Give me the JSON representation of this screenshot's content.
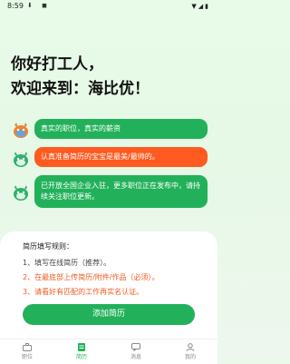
{
  "status": {
    "time": "8:59"
  },
  "headline": {
    "line1": "你好打工人，",
    "line2": "欢迎来到：海比优！"
  },
  "messages": [
    {
      "text": "真实的职位，真实的薪资"
    },
    {
      "text": "认真准备简历的宝宝是最美/最帅的。"
    },
    {
      "text": "已开放全国企业入驻，更多职位正在发布中，请持续关注职位更新。"
    }
  ],
  "card": {
    "title": "简历填写规则：",
    "rules": [
      "1、填写在线简历（推荐）。",
      "2、在最底部上传简历/附件/作品（必须）。",
      "3、请看好有匹配的工作再实名认证。"
    ],
    "button_label": "添加简历"
  },
  "tabs": [
    {
      "label": "职位",
      "icon": "briefcase-icon"
    },
    {
      "label": "简历",
      "icon": "resume-icon"
    },
    {
      "label": "消息",
      "icon": "message-icon"
    },
    {
      "label": "我的",
      "icon": "user-icon"
    }
  ],
  "colors": {
    "accent_green": "#22b15a",
    "accent_orange": "#ff5a1f",
    "text_orange": "#f05a22"
  }
}
